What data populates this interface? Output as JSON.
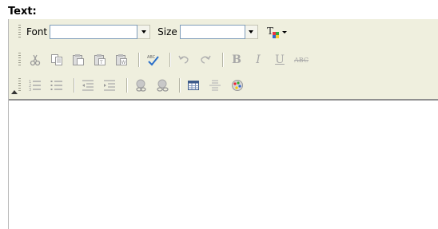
{
  "field": {
    "label": "Text:"
  },
  "toolbar": {
    "font_label": "Font",
    "font_value": "",
    "size_label": "Size",
    "size_value": "",
    "bold_glyph": "B",
    "italic_glyph": "I",
    "underline_glyph": "U",
    "strike_glyph": "ABC"
  },
  "editor": {
    "content": ""
  },
  "icons": [
    "text-color-icon",
    "cut-icon",
    "copy-icon",
    "paste-icon",
    "paste-text-icon",
    "paste-word-icon",
    "spellcheck-icon",
    "undo-icon",
    "redo-icon",
    "bold-icon",
    "italic-icon",
    "underline-icon",
    "strikethrough-icon",
    "ordered-list-icon",
    "unordered-list-icon",
    "outdent-icon",
    "indent-icon",
    "link-icon",
    "unlink-icon",
    "table-icon",
    "horizontal-rule-icon",
    "image-icon"
  ]
}
